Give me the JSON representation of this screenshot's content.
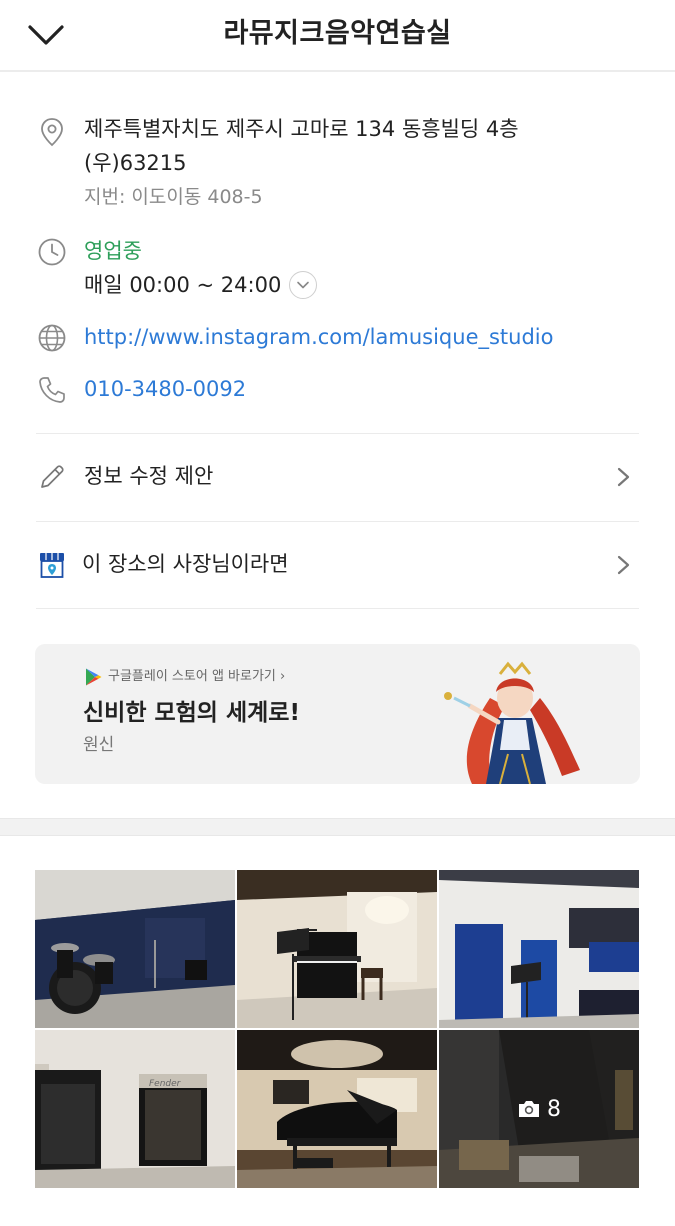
{
  "header": {
    "title": "라뮤지크음악연습실"
  },
  "info": {
    "address": "제주특별자치도 제주시 고마로 134 동흥빌딩 4층",
    "postal": "(우)63215",
    "lot_address": "지번: 이도이동 408-5",
    "status": "영업중",
    "hours": "매일 00:00 ~ 24:00",
    "website": "http://www.instagram.com/lamusique_studio",
    "phone": "010-3480-0092"
  },
  "actions": {
    "suggest_edit": "정보 수정 제안",
    "owner": "이 장소의 사장님이라면"
  },
  "ad": {
    "store_link": "구글플레이 스토어 앱 바로가기 ›",
    "headline": "신비한 모험의 세계로!",
    "brand": "원신"
  },
  "photos": {
    "more_count": "8"
  },
  "colors": {
    "status_green": "#2e9f5a",
    "link_blue": "#2d7ad6",
    "ad_background": "#f2f2f2"
  },
  "icons": {
    "back": "chevron-down-icon",
    "address": "map-pin-icon",
    "hours": "clock-icon",
    "website": "globe-icon",
    "phone": "phone-icon",
    "edit": "pencil-icon",
    "owner": "store-icon",
    "more_photos": "camera-icon"
  }
}
